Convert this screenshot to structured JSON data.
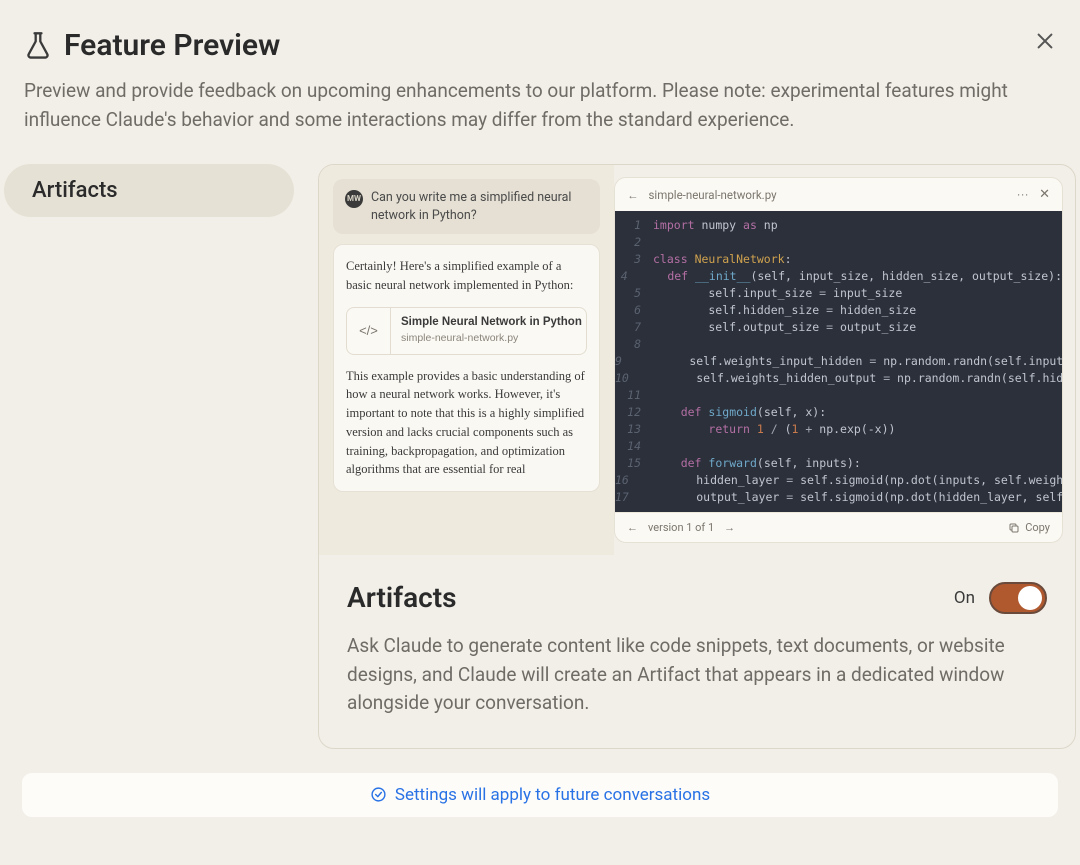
{
  "header": {
    "title": "Feature Preview",
    "subtitle": "Preview and provide feedback on upcoming enhancements to our platform. Please note: experimental features might influence Claude's behavior and some interactions may differ from the standard experience."
  },
  "sidebar": {
    "items": [
      {
        "label": "Artifacts"
      }
    ]
  },
  "chat": {
    "avatar": "MW",
    "user_msg": "Can you write me a simplified neural network in Python?",
    "assistant_intro": "Certainly! Here's a simplified example of a basic neural network implemented in Python:",
    "artifact_card": {
      "title": "Simple Neural Network in Python",
      "filename": "simple-neural-network.py",
      "icon": "</>"
    },
    "assistant_followup": "This example provides a basic understanding of how a neural network works. However, it's important to note that this is a highly simplified version and lacks crucial components such as training, backpropagation, and optimization algorithms that are essential for real"
  },
  "code_panel": {
    "back_glyph": "←",
    "filename": "simple-neural-network.py",
    "dots": "···",
    "close_glyph": "✕",
    "prev_glyph": "←",
    "next_glyph": "→",
    "version_text": "version 1 of 1",
    "copy_label": "Copy",
    "lines": [
      {
        "n": 1,
        "html": "<span class='tok-kw'>import</span> numpy <span class='tok-as'>as</span> np"
      },
      {
        "n": 2,
        "html": ""
      },
      {
        "n": 3,
        "html": "<span class='tok-kw'>class</span> <span class='tok-cls'>NeuralNetwork</span>:"
      },
      {
        "n": 4,
        "html": "    <span class='tok-kw'>def</span> <span class='tok-fn'>__init__</span>(self, input_size, hidden_size, output_size):"
      },
      {
        "n": 5,
        "html": "        self.input_size <span class='tok-op'>=</span> input_size"
      },
      {
        "n": 6,
        "html": "        self.hidden_size <span class='tok-op'>=</span> hidden_size"
      },
      {
        "n": 7,
        "html": "        self.output_size <span class='tok-op'>=</span> output_size"
      },
      {
        "n": 8,
        "html": ""
      },
      {
        "n": 9,
        "html": "        self.weights_input_hidden <span class='tok-op'>=</span> np.random.randn(self.input_size"
      },
      {
        "n": 10,
        "html": "        self.weights_hidden_output <span class='tok-op'>=</span> np.random.randn(self.hidden_s"
      },
      {
        "n": 11,
        "html": ""
      },
      {
        "n": 12,
        "html": "    <span class='tok-kw'>def</span> <span class='tok-fn'>sigmoid</span>(self, x):"
      },
      {
        "n": 13,
        "html": "        <span class='tok-kw'>return</span> <span class='tok-num'>1</span> <span class='tok-op'>/</span> (<span class='tok-num'>1</span> <span class='tok-op'>+</span> np.exp(-x))"
      },
      {
        "n": 14,
        "html": ""
      },
      {
        "n": 15,
        "html": "    <span class='tok-kw'>def</span> <span class='tok-fn'>forward</span>(self, inputs):"
      },
      {
        "n": 16,
        "html": "        hidden_layer <span class='tok-op'>=</span> self.sigmoid(np.dot(inputs, self.weights_inp"
      },
      {
        "n": 17,
        "html": "        output_layer <span class='tok-op'>=</span> self.sigmoid(np.dot(hidden_layer, self.weigh"
      }
    ]
  },
  "feature": {
    "title": "Artifacts",
    "state_label": "On",
    "description": "Ask Claude to generate content like code snippets, text documents, or website designs, and Claude will create an Artifact that appears in a dedicated window alongside your conversation."
  },
  "footer": {
    "message": "Settings will apply to future conversations"
  }
}
